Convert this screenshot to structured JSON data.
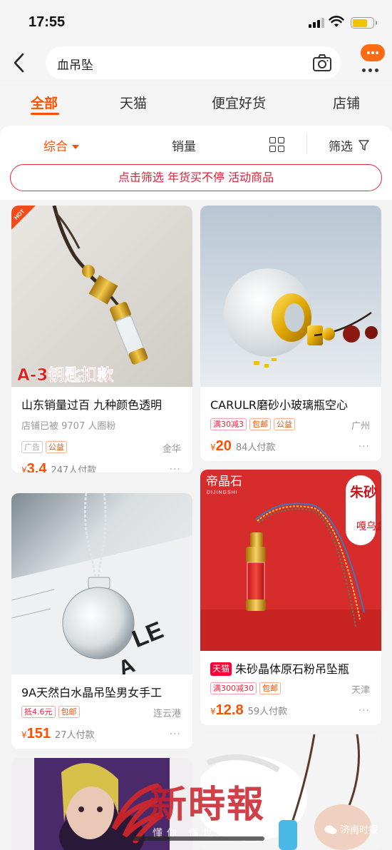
{
  "status": {
    "time": "17:55"
  },
  "search": {
    "query": "血吊坠"
  },
  "tabs": [
    "全部",
    "天猫",
    "便宜好货",
    "店铺"
  ],
  "sort": {
    "comprehensive": "综合",
    "sales": "销量",
    "filter": "筛选"
  },
  "promo": "点击筛选 年货买不停 活动商品",
  "products": [
    {
      "img_text": "A-3钥匙扣款",
      "badge": "HOT",
      "title": "山东销量过百 九种颜色透明",
      "sub": "店铺已被 9707 人圈粉",
      "tags": [
        "广告",
        "公益"
      ],
      "location": "金华",
      "yen": "¥",
      "price": "3.4",
      "sold": "247人付款",
      "more": "···"
    },
    {
      "title": "CARULR磨砂小玻璃瓶空心",
      "tags": [
        "满30减3",
        "包邮",
        "公益"
      ],
      "location": "广州",
      "yen": "¥",
      "price": "20",
      "sold": "84人付款",
      "more": "···"
    },
    {
      "title": "9A天然白水晶吊坠男女手工",
      "tags": [
        "抵4.6元",
        "包邮"
      ],
      "location": "连云港",
      "yen": "¥",
      "price": "151",
      "sold": "27人付款",
      "more": "···"
    },
    {
      "brand_cn": "帝晶石",
      "brand_en": "DIJINGSHI",
      "vertical_1": "朱砂",
      "vertical_2": "嘎乌盒",
      "tmall": "天猫",
      "title": "朱砂晶体原石粉吊坠瓶",
      "tags": [
        "满300减30",
        "包邮"
      ],
      "location": "天津",
      "yen": "¥",
      "price": "12.8",
      "sold": "59人付款",
      "more": "···"
    }
  ],
  "watermark": {
    "main": "新時報",
    "slogan": "懂你 懂世界",
    "account": "济南时报"
  },
  "colors": {
    "accent": "#ff5000",
    "promo_red": "#f0263f",
    "tmall": "#ff0036"
  }
}
